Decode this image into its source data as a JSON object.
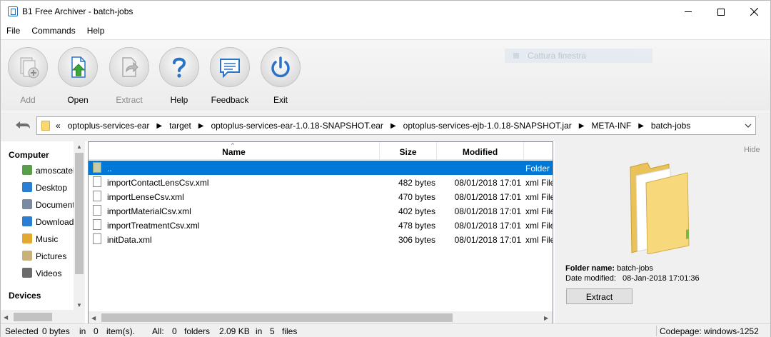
{
  "window": {
    "title": "B1 Free Archiver - batch-jobs"
  },
  "menu": [
    "File",
    "Commands",
    "Help"
  ],
  "toolbar": {
    "items": [
      {
        "label": "Add",
        "disabled": true
      },
      {
        "label": "Open",
        "disabled": false
      },
      {
        "label": "Extract",
        "disabled": true
      },
      {
        "label": "Help",
        "disabled": false
      },
      {
        "label": "Feedback",
        "disabled": false
      },
      {
        "label": "Exit",
        "disabled": false
      }
    ],
    "ghost_label": "Cattura finestra"
  },
  "address": {
    "prefix": "«",
    "crumbs": [
      "optoplus-services-ear",
      "target",
      "optoplus-services-ear-1.0.18-SNAPSHOT.ear",
      "optoplus-services-ejb-1.0.18-SNAPSHOT.jar",
      "META-INF",
      "batch-jobs"
    ]
  },
  "tree": {
    "computer_heading": "Computer",
    "items": [
      {
        "label": "amoscatelli",
        "icon": "user-icon",
        "color": "#5a9e4b"
      },
      {
        "label": "Desktop",
        "icon": "desktop-icon",
        "color": "#2a7fd4"
      },
      {
        "label": "Documents",
        "icon": "documents-icon",
        "color": "#7a8aa0"
      },
      {
        "label": "Downloads",
        "icon": "downloads-icon",
        "color": "#2a7fd4"
      },
      {
        "label": "Music",
        "icon": "music-icon",
        "color": "#e2a82f"
      },
      {
        "label": "Pictures",
        "icon": "pictures-icon",
        "color": "#c9b27a"
      },
      {
        "label": "Videos",
        "icon": "videos-icon",
        "color": "#6b6b6b"
      }
    ],
    "devices_heading": "Devices"
  },
  "filelist": {
    "columns": {
      "name": "Name",
      "size": "Size",
      "modified": "Modified"
    },
    "rows": [
      {
        "name": "..",
        "size": "",
        "modified": "",
        "type": "Folder",
        "folder": true,
        "selected": true
      },
      {
        "name": "importContactLensCsv.xml",
        "size": "482 bytes",
        "modified": "08/01/2018 17:01",
        "type": "xml File",
        "folder": false,
        "selected": false
      },
      {
        "name": "importLenseCsv.xml",
        "size": "470 bytes",
        "modified": "08/01/2018 17:01",
        "type": "xml File",
        "folder": false,
        "selected": false
      },
      {
        "name": "importMaterialCsv.xml",
        "size": "402 bytes",
        "modified": "08/01/2018 17:01",
        "type": "xml File",
        "folder": false,
        "selected": false
      },
      {
        "name": "importTreatmentCsv.xml",
        "size": "478 bytes",
        "modified": "08/01/2018 17:01",
        "type": "xml File",
        "folder": false,
        "selected": false
      },
      {
        "name": "initData.xml",
        "size": "306 bytes",
        "modified": "08/01/2018 17:01",
        "type": "xml File",
        "folder": false,
        "selected": false
      }
    ]
  },
  "preview": {
    "hide_label": "Hide",
    "folder_name_label": "Folder name:",
    "folder_name": "batch-jobs",
    "date_label": "Date modified:",
    "date_value": "08-Jan-2018 17:01:36",
    "extract_label": "Extract"
  },
  "status": {
    "selected_label": "Selected",
    "selected_bytes": "0 bytes",
    "in1": "in",
    "selected_items": "0",
    "items_label": "item(s).",
    "all_label": "All:",
    "folders_count": "0",
    "folders_label": "folders",
    "total_size": "2.09 KB",
    "in2": "in",
    "files_count": "5",
    "files_label": "files",
    "codepage": "Codepage: windows-1252"
  },
  "colors": {
    "selection": "#0078d7",
    "accent": "#1f6fbf"
  }
}
